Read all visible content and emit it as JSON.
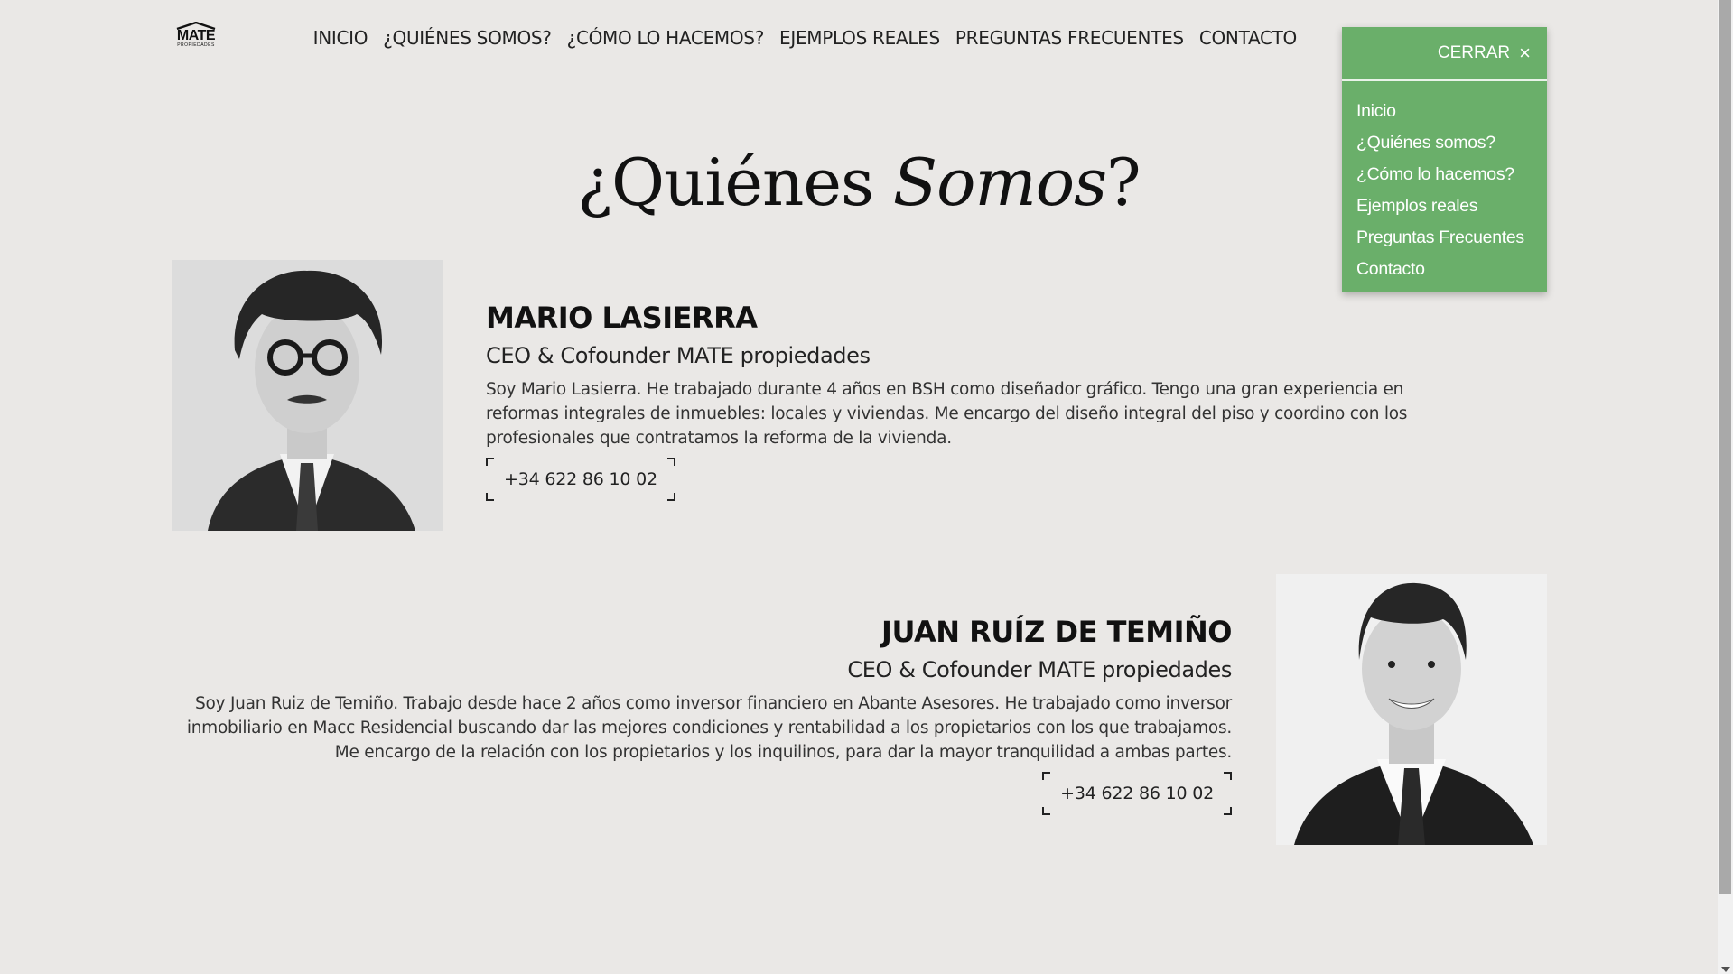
{
  "brand": {
    "logo_main": "MATE",
    "logo_sub": "PROPIEDADES"
  },
  "nav": {
    "items": [
      {
        "label": "INICIO"
      },
      {
        "label": "¿QUIÉNES SOMOS?"
      },
      {
        "label": "¿CÓMO LO HACEMOS?"
      },
      {
        "label": "EJEMPLOS REALES"
      },
      {
        "label": "PREGUNTAS FRECUENTES"
      },
      {
        "label": "CONTACTO"
      }
    ]
  },
  "menu": {
    "close_label": "CERRAR",
    "close_icon": "×",
    "items": [
      {
        "label": "Inicio"
      },
      {
        "label": "¿Quiénes somos?"
      },
      {
        "label": "¿Cómo lo hacemos?"
      },
      {
        "label": "Ejemplos reales"
      },
      {
        "label": "Preguntas Frecuentes"
      },
      {
        "label": "Contacto"
      }
    ],
    "accent_color": "#6aaf6a"
  },
  "page": {
    "title_prefix": "¿Quiénes ",
    "title_italic": "Somos",
    "title_suffix": "?"
  },
  "people": [
    {
      "name": "MARIO LASIERRA",
      "role": "CEO & Cofounder MATE propiedades",
      "bio": "Soy Mario Lasierra. He trabajado durante 4 años en BSH como diseñador gráfico. Tengo una gran experiencia en reformas integrales de inmuebles: locales y viviendas. Me encargo del diseño integral del piso y coordino con los profesionales que contratamos la reforma de la vivienda.",
      "phone": "+34 622 86 10 02"
    },
    {
      "name": "JUAN RUÍZ DE TEMIÑO",
      "role": "CEO & Cofounder MATE propiedades",
      "bio": "Soy Juan Ruiz de Temiño. Trabajo desde hace 2 años como inversor financiero en Abante Asesores. He trabajado como inversor inmobiliario en Macc Residencial buscando dar las mejores condiciones y rentabilidad a los propietarios con los que trabajamos. Me encargo de la relación con los propietarios y los inquilinos, para dar la mayor tranquilidad a ambas partes.",
      "phone": "+34 622 86 10 02"
    }
  ]
}
